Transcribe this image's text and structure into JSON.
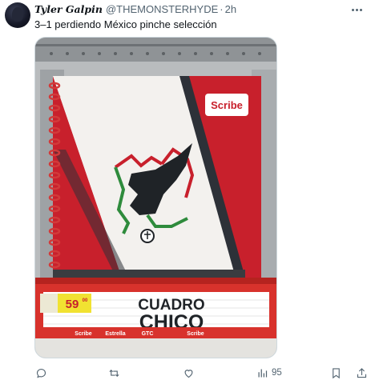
{
  "tweet": {
    "display_name": "Tyler Galpin",
    "handle": "@THEMONSTERHYDE",
    "separator": "·",
    "time": "2h",
    "text": "3–1 perdiendo México pinche selección"
  },
  "media": {
    "brand_label": "Scribe",
    "box_label_line1": "CUADRO",
    "box_label_line2": "CHICO",
    "price_label": "59",
    "price_cents": "00",
    "footer_brands": [
      "Scribe",
      "Estrella",
      "GTC",
      "Scribe"
    ]
  },
  "actions": {
    "reply_icon": "reply-icon",
    "retweet_icon": "retweet-icon",
    "like_icon": "heart-icon",
    "views_icon": "views-icon",
    "views_count": "95",
    "bookmark_icon": "bookmark-icon",
    "share_icon": "share-icon"
  },
  "colors": {
    "accent_red": "#c8202c",
    "muted_text": "#536471"
  }
}
